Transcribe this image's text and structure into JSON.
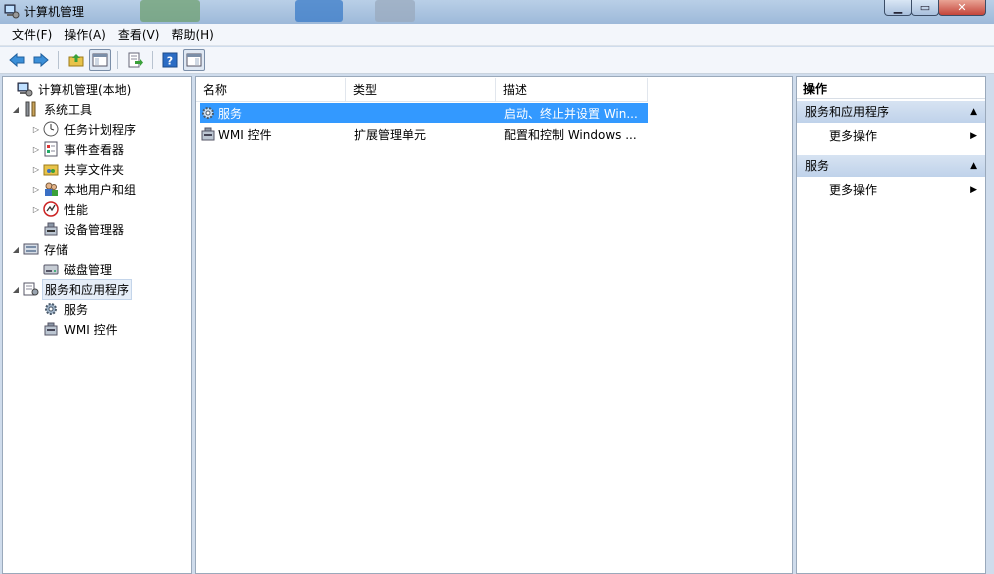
{
  "window": {
    "title": "计算机管理"
  },
  "menubar": [
    "文件(F)",
    "操作(A)",
    "查看(V)",
    "帮助(H)"
  ],
  "toolbar": {
    "icons": [
      "back-arrow-icon",
      "forward-arrow-icon",
      "up-folder-icon",
      "show-hide-tree-icon",
      "export-list-icon",
      "help-icon",
      "show-hide-action-pane-icon"
    ]
  },
  "tree": {
    "items": [
      {
        "label": "计算机管理(本地)",
        "icon": "computer-management-icon"
      },
      {
        "label": "系统工具",
        "icon": "system-tools-icon"
      },
      {
        "label": "任务计划程序",
        "icon": "clock-icon"
      },
      {
        "label": "事件查看器",
        "icon": "event-viewer-icon"
      },
      {
        "label": "共享文件夹",
        "icon": "shared-folder-icon"
      },
      {
        "label": "本地用户和组",
        "icon": "users-icon"
      },
      {
        "label": "性能",
        "icon": "performance-icon"
      },
      {
        "label": "设备管理器",
        "icon": "device-manager-icon"
      },
      {
        "label": "存储",
        "icon": "storage-icon"
      },
      {
        "label": "磁盘管理",
        "icon": "disk-icon"
      },
      {
        "label": "服务和应用程序",
        "icon": "services-apps-icon"
      },
      {
        "label": "服务",
        "icon": "gear-icon"
      },
      {
        "label": "WMI 控件",
        "icon": "wmi-icon"
      }
    ]
  },
  "list": {
    "columns": [
      "名称",
      "类型",
      "描述"
    ],
    "rows": [
      {
        "name": "服务",
        "type": "",
        "desc": "启动、终止并设置 Win..."
      },
      {
        "name": "WMI 控件",
        "type": "扩展管理单元",
        "desc": "配置和控制 Windows ..."
      }
    ]
  },
  "actions": {
    "title": "操作",
    "sections": [
      {
        "title": "服务和应用程序",
        "link": "更多操作"
      },
      {
        "title": "服务",
        "link": "更多操作"
      }
    ]
  },
  "colors": {
    "selection": "#3399ff",
    "titlebar": "#b9cfe7",
    "section_header": "#c9daef"
  }
}
